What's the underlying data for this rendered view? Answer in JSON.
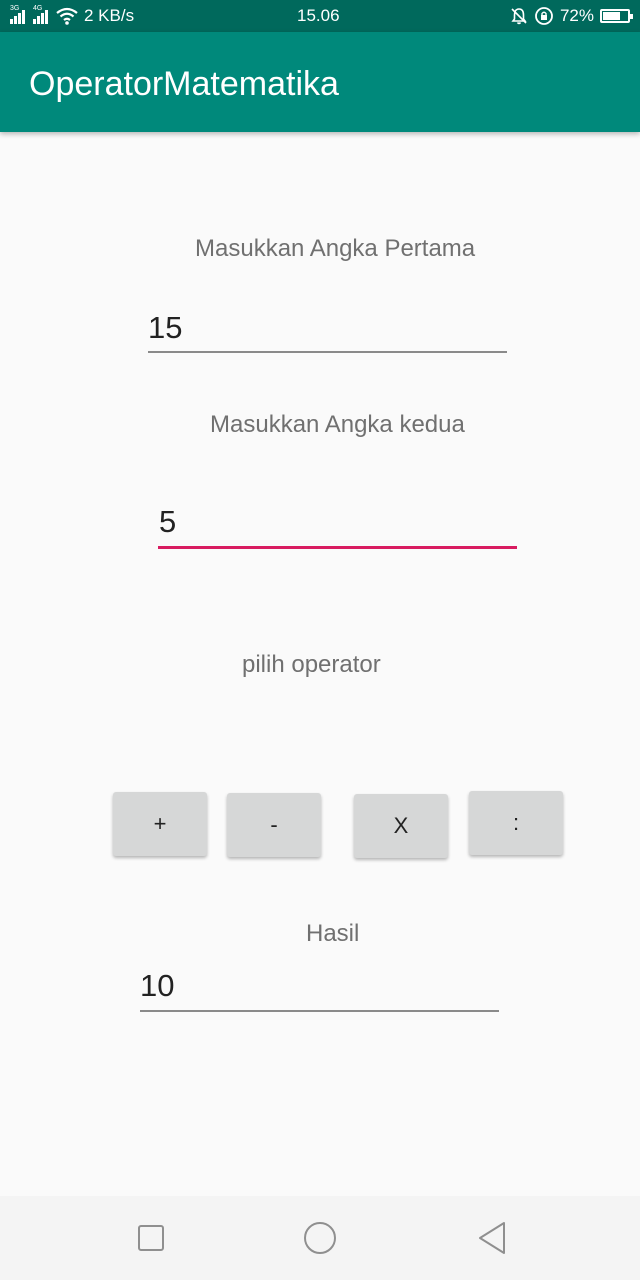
{
  "status_bar": {
    "network_labels": [
      "3G",
      "4G"
    ],
    "net_speed": "2 KB/s",
    "time": "15.06",
    "battery_percent": "72%",
    "battery_level": 0.72,
    "icons": [
      "signal-3g-icon",
      "signal-4g-icon",
      "wifi-icon",
      "mute-bell-icon",
      "rotation-lock-icon",
      "battery-icon"
    ]
  },
  "app_bar": {
    "title": "OperatorMatematika",
    "background": "#00897b",
    "status_background": "#00695c"
  },
  "form": {
    "first_label": "Masukkan Angka Pertama",
    "first_value": "15",
    "second_label": "Masukkan Angka kedua",
    "second_value": "5",
    "operator_label": "pilih operator",
    "operators": [
      "+",
      "-",
      "X",
      ":"
    ],
    "result_label": "Hasil",
    "result_value": "10",
    "accent_color": "#d81b60"
  },
  "nav_bar": {
    "icons": [
      "recent-apps-icon",
      "home-icon",
      "back-icon"
    ]
  }
}
